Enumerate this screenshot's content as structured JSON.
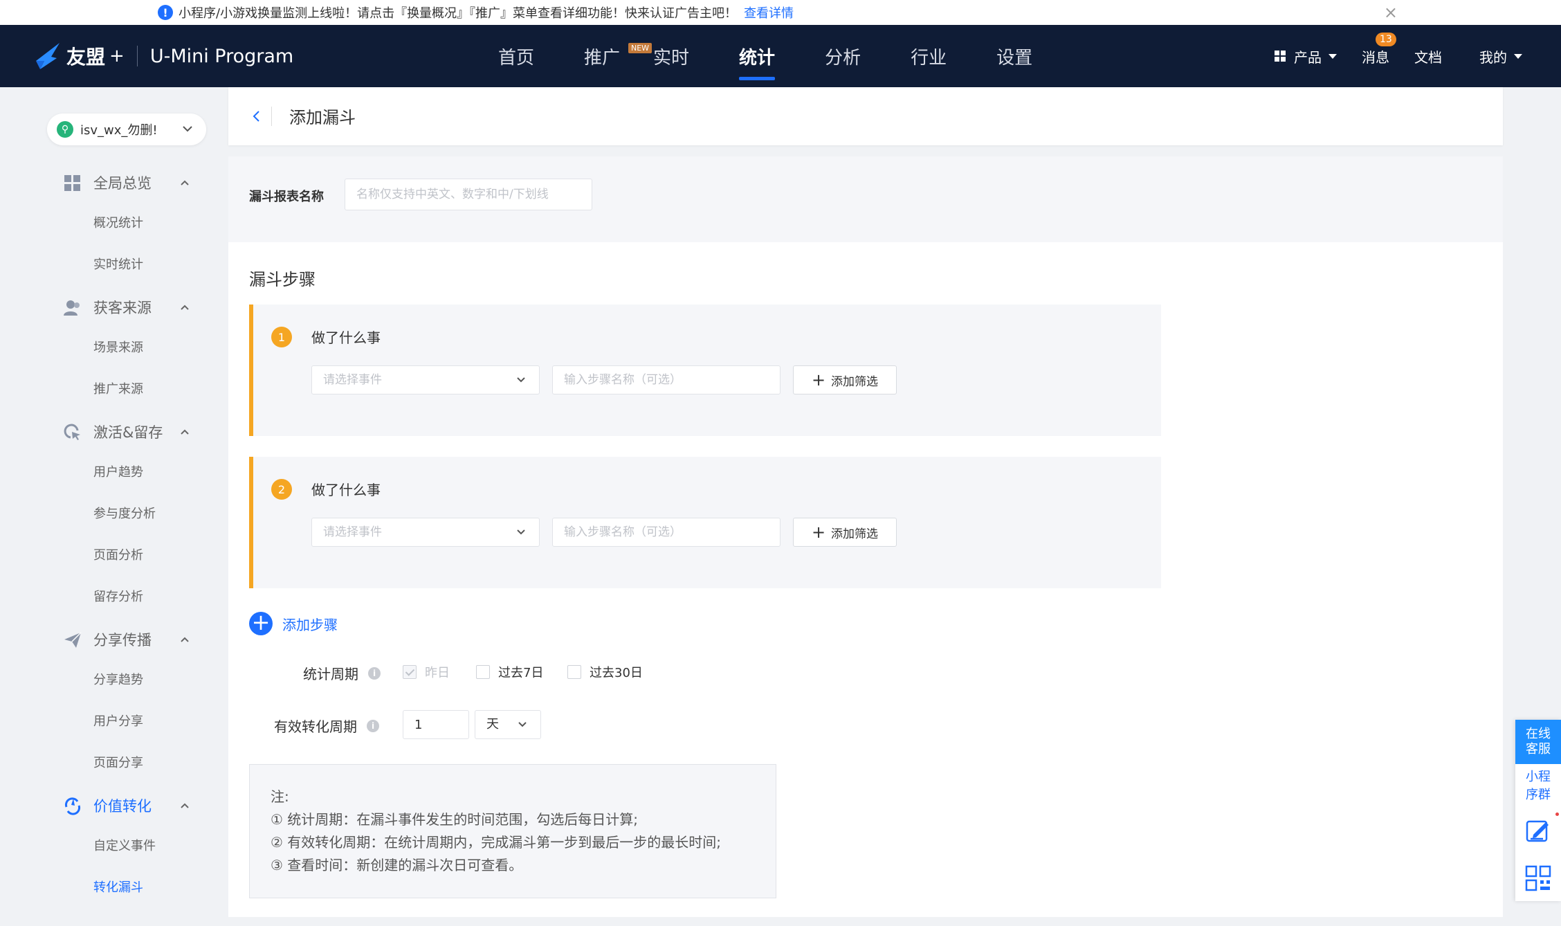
{
  "notice": {
    "text": "小程序/小游戏换量监测上线啦！请点击『换量概况』『推广』菜单查看详细功能！快来认证广告主吧！",
    "link": "查看详情",
    "close": "×",
    "info_icon": "!"
  },
  "header": {
    "brand": "友盟",
    "plus": "+",
    "product": "U-Mini Program",
    "nav": [
      {
        "label": "首页"
      },
      {
        "label": "推广",
        "tag": "NEW"
      },
      {
        "label": "实时"
      },
      {
        "label": "统计",
        "active": true
      },
      {
        "label": "分析"
      },
      {
        "label": "行业"
      },
      {
        "label": "设置"
      }
    ],
    "right": {
      "products": "产品",
      "messages": "消息",
      "message_count": "13",
      "docs": "文档",
      "mine": "我的"
    }
  },
  "sidebar": {
    "app_name": "isv_wx_勿删!",
    "groups": [
      {
        "label": "全局总览",
        "icon": "dashboard-icon",
        "items": [
          "概况统计",
          "实时统计"
        ]
      },
      {
        "label": "获客来源",
        "icon": "users-icon",
        "items": [
          "场景来源",
          "推广来源"
        ]
      },
      {
        "label": "激活&留存",
        "icon": "cursor-icon",
        "items": [
          "用户趋势",
          "参与度分析",
          "页面分析",
          "留存分析"
        ]
      },
      {
        "label": "分享传播",
        "icon": "send-icon",
        "items": [
          "分享趋势",
          "用户分享",
          "页面分享"
        ]
      },
      {
        "label": "价值转化",
        "icon": "convert-icon",
        "active": true,
        "items": [
          "自定义事件",
          "转化漏斗"
        ]
      }
    ],
    "active_item": "转化漏斗"
  },
  "page": {
    "title": "添加漏斗",
    "report_name_label": "漏斗报表名称",
    "report_name_placeholder": "名称仅支持中英文、数字和中/下划线",
    "steps_title": "漏斗步骤",
    "steps": [
      {
        "num": "1",
        "title": "做了什么事",
        "event_placeholder": "请选择事件",
        "name_placeholder": "输入步骤名称（可选）",
        "filter": "添加筛选"
      },
      {
        "num": "2",
        "title": "做了什么事",
        "event_placeholder": "请选择事件",
        "name_placeholder": "输入步骤名称（可选）",
        "filter": "添加筛选"
      }
    ],
    "add_step": "添加步骤",
    "period_label": "统计周期",
    "period_options": [
      {
        "label": "昨日",
        "checked": true,
        "disabled": true
      },
      {
        "label": "过去7日",
        "checked": false
      },
      {
        "label": "过去30日",
        "checked": false
      }
    ],
    "conversion_label": "有效转化周期",
    "conversion_value": "1",
    "conversion_unit": "天",
    "notes": [
      "注:",
      "① 统计周期：在漏斗事件发生的时间范围，勾选后每日计算;",
      "② 有效转化周期：在统计周期内，完成漏斗第一步到最后一步的最长时间;",
      "③ 查看时间：新创建的漏斗次日可查看。"
    ]
  },
  "float": {
    "online_service": "在线客服",
    "group": "小程序群"
  },
  "colors": {
    "primary": "#1e6fff",
    "header_bg": "#0f1c36",
    "step_accent": "#f5a623",
    "badge": "#f08a24"
  }
}
